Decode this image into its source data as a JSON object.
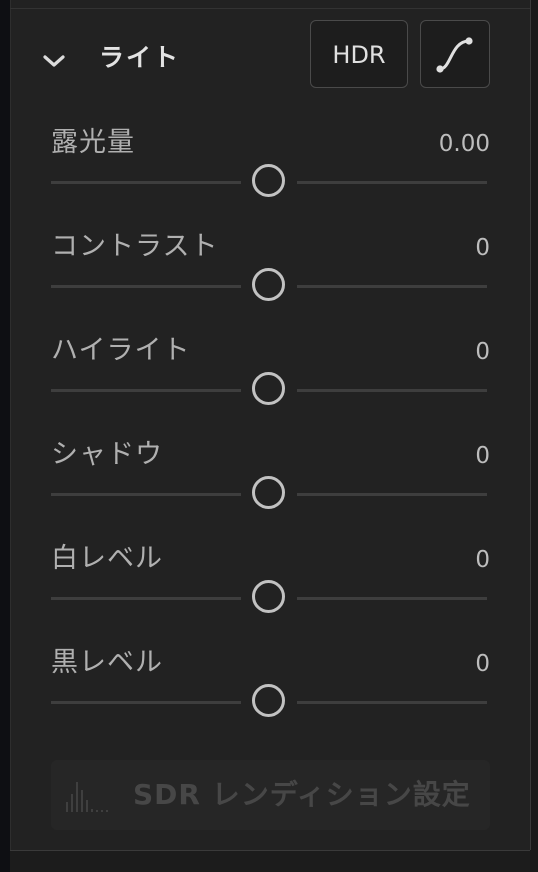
{
  "panel": {
    "title": "ライト",
    "hdr_label": "HDR",
    "sliders": [
      {
        "label": "露光量",
        "value": "0.00",
        "position": 0.5
      },
      {
        "label": "コントラスト",
        "value": "0",
        "position": 0.5
      },
      {
        "label": "ハイライト",
        "value": "0",
        "position": 0.5
      },
      {
        "label": "シャドウ",
        "value": "0",
        "position": 0.5
      },
      {
        "label": "白レベル",
        "value": "0",
        "position": 0.5
      },
      {
        "label": "黒レベル",
        "value": "0",
        "position": 0.5
      }
    ],
    "sdr_button_label": "SDR レンディション設定"
  },
  "icons": {
    "collapse": "chevron-down-icon",
    "curve": "tone-curve-icon",
    "histogram": "histogram-icon"
  },
  "colors": {
    "panel_bg": "#222222",
    "text_primary": "#e3e3e3",
    "text_secondary": "#b0b0b0",
    "slider_thumb": "#c2c2c2",
    "disabled_text": "#474747"
  }
}
